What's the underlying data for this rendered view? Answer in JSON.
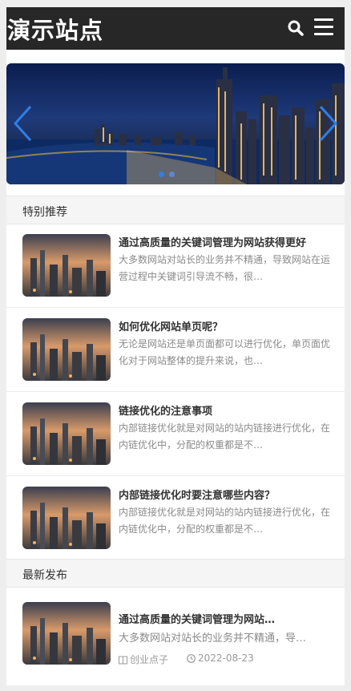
{
  "site": {
    "title": "演示站点"
  },
  "header": {
    "search_icon": "search-icon",
    "menu_icon": "menu-icon"
  },
  "banner": {
    "slide_count": 2,
    "active_slide": 1,
    "prev_icon": "chevron-left-icon",
    "next_icon": "chevron-right-icon"
  },
  "featured": {
    "heading": "特别推荐",
    "posts": [
      {
        "title": "通过高质量的关键词管理为网站获得更好",
        "excerpt": "大多数网站对站长的业务并不精通，导致网站在运营过程中关键词引导流不畅，很…"
      },
      {
        "title": "如何优化网站单页呢？",
        "excerpt": "无论是网站还是单页面都可以进行优化，单页面优化对于网站整体的提升来说，也…"
      },
      {
        "title": "链接优化的注意事项",
        "excerpt": "内部链接优化就是对网站的站内链接进行优化，在内链优化中，分配的权重都是不…"
      },
      {
        "title": "内部链接优化时要注意哪些内容？",
        "excerpt": "内部链接优化就是对网站的站内链接进行优化，在内链优化中，分配的权重都是不…"
      }
    ]
  },
  "latest": {
    "heading": "最新发布",
    "posts": [
      {
        "title": "通过高质量的关键词管理为网站…",
        "excerpt": "大多数网站对站长的业务并不精通，导…",
        "category": "创业点子",
        "date": "2022-08-23"
      }
    ]
  },
  "colors": {
    "header_bg": "#272727",
    "accent": "#2f7fe6"
  }
}
